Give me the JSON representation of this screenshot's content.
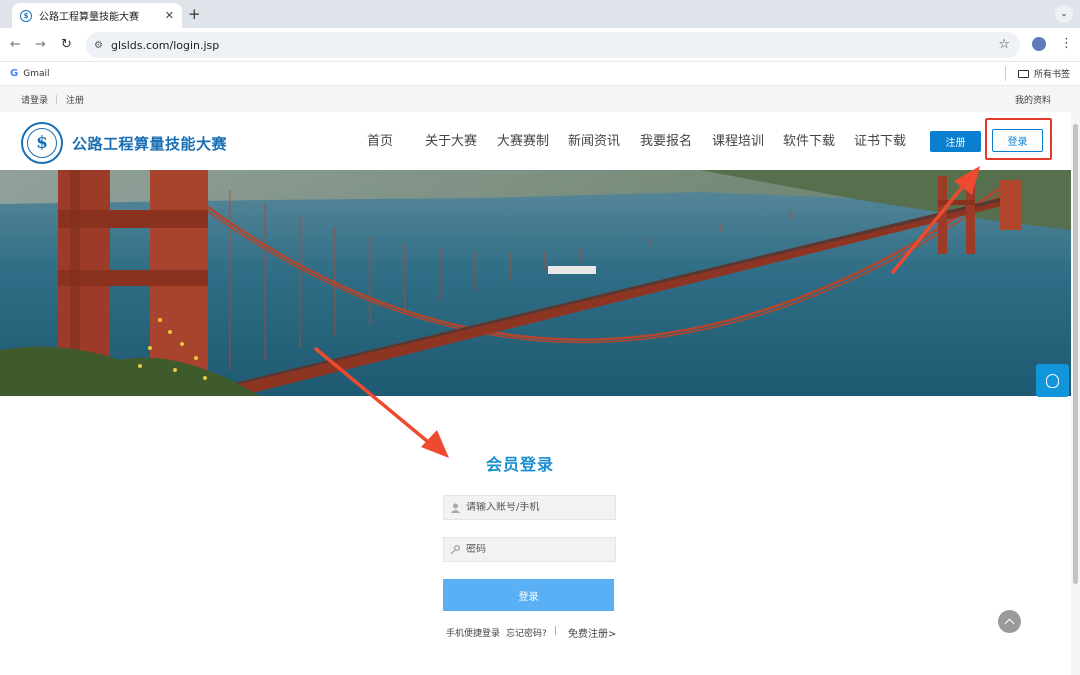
{
  "browser": {
    "tab_title": "公路工程算量技能大赛",
    "url": "glslds.com/login.jsp",
    "bookmarks": {
      "gmail": "Gmail",
      "all_bookmarks": "所有书签"
    }
  },
  "topbar": {
    "login_link": "请登录",
    "register_link": "注册",
    "my_profile": "我的资料"
  },
  "header": {
    "brand": "公路工程算量技能大赛",
    "nav": [
      "首页",
      "关于大赛",
      "大赛赛制",
      "新闻资讯",
      "我要报名",
      "课程培训",
      "软件下载",
      "证书下载"
    ],
    "register_button": "注册",
    "login_button": "登录"
  },
  "login_form": {
    "title": "会员登录",
    "account_placeholder": "请输入账号/手机",
    "password_placeholder": "密码",
    "submit_label": "登录",
    "phone_login": "手机便捷登录",
    "forgot_password": "忘记密码?",
    "divider": "|",
    "free_register": "免费注册>"
  },
  "colors": {
    "brand_blue": "#1a6fb5",
    "accent": "#0a7fd0",
    "submit": "#5ab0f5",
    "annotation_red": "#e53a2c"
  },
  "icons": [
    "site-favicon",
    "back-arrow-icon",
    "forward-arrow-icon",
    "reload-icon",
    "site-info-icon",
    "star-icon",
    "profile-icon",
    "menu-icon",
    "folder-icon",
    "logo-icon",
    "qq-chat-icon",
    "user-icon",
    "key-icon",
    "back-to-top-icon"
  ]
}
